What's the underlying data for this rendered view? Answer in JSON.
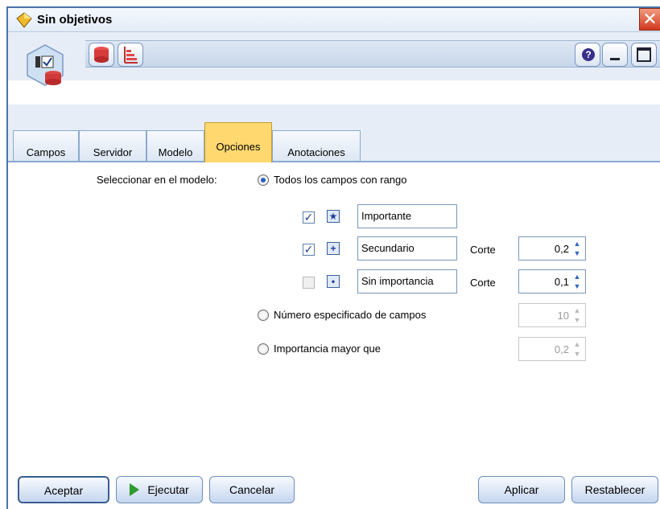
{
  "window": {
    "title": "Sin objetivos"
  },
  "tabs": [
    "Campos",
    "Servidor",
    "Modelo",
    "Opciones",
    "Anotaciones"
  ],
  "options": {
    "select_label": "Seleccionar en el modelo:",
    "radio_all_ranked": "Todos los campos con rango",
    "rows": [
      {
        "checked": true,
        "icon": "★",
        "value": "Importante"
      },
      {
        "checked": true,
        "icon": "+",
        "value": "Secundario",
        "cut_label": "Corte",
        "cut_value": "0,2"
      },
      {
        "checked": false,
        "icon": "•",
        "value": "Sin importancia",
        "cut_label": "Corte",
        "cut_value": "0,1"
      }
    ],
    "radio_top_n": "Número especificado de campos",
    "top_n_value": "10",
    "radio_importance": "Importancia mayor que",
    "importance_value": "0,2"
  },
  "buttons": {
    "ok": "Aceptar",
    "run": "Ejecutar",
    "cancel": "Cancelar",
    "apply": "Aplicar",
    "reset": "Restablecer"
  },
  "colors": {
    "active_tab": "#ffd870",
    "header_bg": "#e6edf6",
    "accent": "#4a73ab"
  }
}
